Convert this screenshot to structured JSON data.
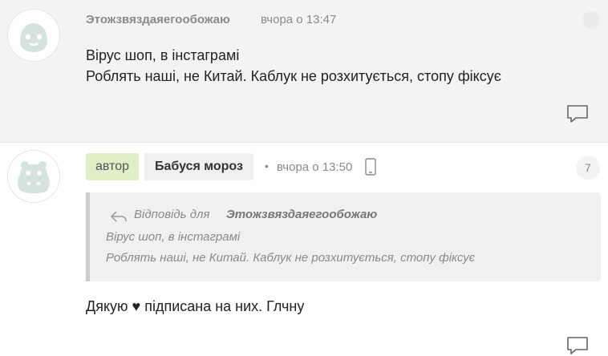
{
  "comments": [
    {
      "author": "Этожзвяздаяегообожаю",
      "time": "вчора о 13:47",
      "lines": [
        "Вірус шоп, в інстаграмі",
        "Роблять наші, не Китай. Каблук не розхитується, стопу фіксує"
      ],
      "avatar_icon": "penguin-avatar-icon",
      "reply_icon": "reply-bubble-icon"
    },
    {
      "author_badge": "автор",
      "author": "Бабуся мороз",
      "bullet": "•",
      "time": "вчора о 13:50",
      "device_icon": "mobile-phone-icon",
      "count": "7",
      "avatar_icon": "hippo-avatar-icon",
      "quote": {
        "label": "Відповідь для",
        "author": "Этожзвяздаяегообожаю",
        "lines": [
          "Вірус шоп, в інстаграмі",
          "Роблять наші, не Китай. Каблук не розхитується, стопу фіксує"
        ]
      },
      "text": "Дякую ♥ підписана на них. Глчну",
      "reply_icon": "reply-bubble-icon"
    }
  ],
  "colors": {
    "comment_bg": "#f3f3f3",
    "author_badge_bg": "#dff0c8",
    "muted_text": "#8a8a8a",
    "avatar_line": "#cfdcd5"
  }
}
